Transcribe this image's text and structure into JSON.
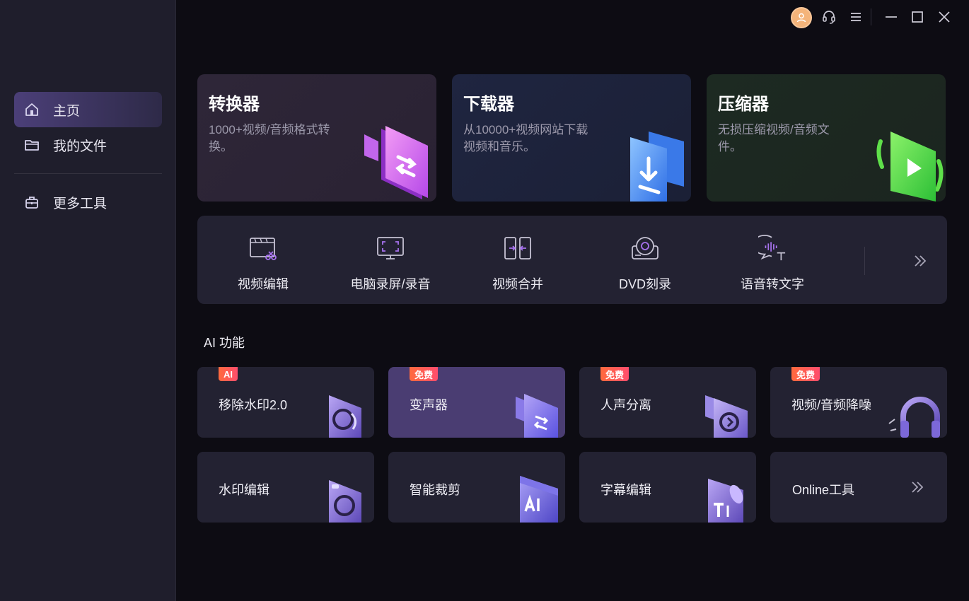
{
  "sidebar": {
    "items": [
      {
        "label": "主页",
        "icon": "home-icon",
        "active": true
      },
      {
        "label": "我的文件",
        "icon": "folder-icon"
      },
      {
        "label": "更多工具",
        "icon": "toolbox-icon"
      }
    ]
  },
  "titlebar": {
    "icons": [
      "user-avatar-icon",
      "headset-icon",
      "menu-icon",
      "minimize-icon",
      "maximize-icon",
      "close-icon"
    ]
  },
  "hero": [
    {
      "title": "转换器",
      "desc": "1000+视频/音频格式转换。"
    },
    {
      "title": "下载器",
      "desc": "从10000+视频网站下载视频和音乐。"
    },
    {
      "title": "压缩器",
      "desc": "无损压缩视频/音频文件。"
    }
  ],
  "tools": [
    {
      "label": "视频编辑",
      "icon": "video-edit-icon"
    },
    {
      "label": "电脑录屏/录音",
      "icon": "screen-record-icon"
    },
    {
      "label": "视频合并",
      "icon": "merge-icon"
    },
    {
      "label": "DVD刻录",
      "icon": "dvd-icon"
    },
    {
      "label": "语音转文字",
      "icon": "speech-to-text-icon"
    }
  ],
  "ai_section": {
    "title": "AI 功能"
  },
  "cards": [
    {
      "label": "移除水印2.0",
      "badge": "AI"
    },
    {
      "label": "变声器",
      "badge": "免费"
    },
    {
      "label": "人声分离",
      "badge": "免费"
    },
    {
      "label": "视频/音频降噪",
      "badge": "免费"
    },
    {
      "label": "水印编辑"
    },
    {
      "label": "智能裁剪"
    },
    {
      "label": "字幕编辑"
    },
    {
      "label": "Online工具"
    }
  ],
  "colors": {
    "accent": "#4a3d72",
    "badge": "#ff5a4a",
    "sidebar_bg": "#1f1e2c",
    "main_bg": "#0d0c13"
  }
}
